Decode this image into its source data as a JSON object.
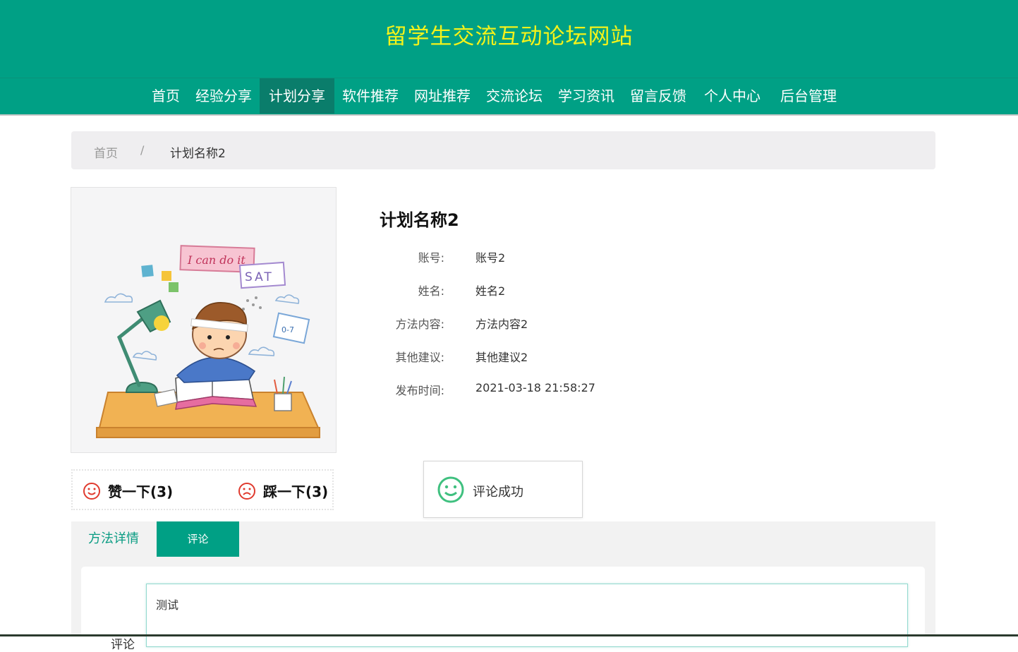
{
  "site": {
    "title": "留学生交流互动论坛网站"
  },
  "nav": {
    "items": [
      {
        "label": "首页"
      },
      {
        "label": "经验分享"
      },
      {
        "label": "计划分享",
        "active": true
      },
      {
        "label": "软件推荐"
      },
      {
        "label": "网址推荐"
      },
      {
        "label": "交流论坛"
      },
      {
        "label": "学习资讯"
      },
      {
        "label": "留言反馈"
      },
      {
        "label": "个人中心"
      },
      {
        "label": "后台管理"
      }
    ]
  },
  "breadcrumb": {
    "home": "首页",
    "separator": "/",
    "current": "计划名称2"
  },
  "detail": {
    "title": "计划名称2",
    "fields": [
      {
        "label": "账号:",
        "value": "账号2"
      },
      {
        "label": "姓名:",
        "value": "姓名2"
      },
      {
        "label": "方法内容:",
        "value": "方法内容2"
      },
      {
        "label": "其他建议:",
        "value": "其他建议2"
      },
      {
        "label": "发布时间:",
        "value": "2021-03-18 21:58:27"
      }
    ],
    "image": {
      "caption_text_1": "I can do it",
      "caption_text_2": "SAT",
      "caption_text_3": "0-7"
    }
  },
  "votes": {
    "like_label": "赞一下(3)",
    "dislike_label": "踩一下(3)"
  },
  "toast": {
    "message": "评论成功"
  },
  "tabs": {
    "detail_label": "方法详情",
    "comment_label": "评论"
  },
  "comment_form": {
    "label": "评论",
    "value": "测试"
  },
  "colors": {
    "brand": "#00a085",
    "title": "#f4f21a",
    "active_nav": "#0a7d6b",
    "vote_icon": "#e03a2e",
    "toast_icon": "#3fc07f"
  }
}
